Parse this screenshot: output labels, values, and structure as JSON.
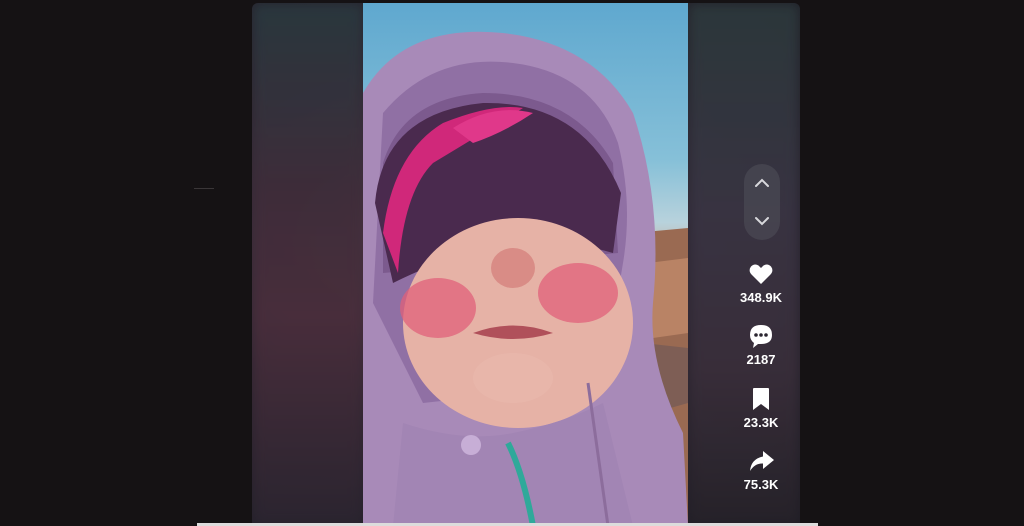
{
  "actions": {
    "like": {
      "icon": "heart-icon",
      "count": "348.9K"
    },
    "comment": {
      "icon": "comment-icon",
      "count": "2187"
    },
    "save": {
      "icon": "bookmark-icon",
      "count": "23.3K"
    },
    "share": {
      "icon": "share-icon",
      "count": "75.3K"
    }
  },
  "navigation": {
    "previous_icon": "chevron-up-icon",
    "next_icon": "chevron-down-icon"
  },
  "colors": {
    "page_background": "#151214",
    "icon_color": "#ffffff",
    "nav_pill": "rgba(80,80,90,.55)"
  }
}
